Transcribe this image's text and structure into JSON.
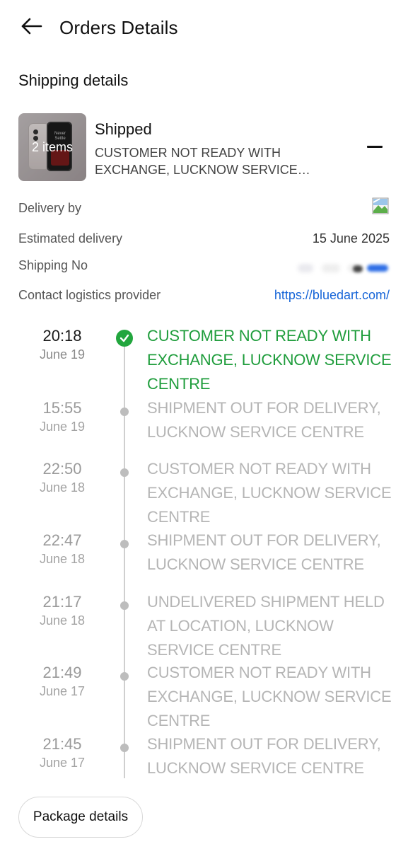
{
  "header": {
    "title": "Orders Details"
  },
  "shipping": {
    "section_title": "Shipping details",
    "thumb_count": "2 items",
    "thumb_screen_text": "Never Settle",
    "status": "Shipped",
    "description": "CUSTOMER NOT READY WITH EXCHANGE, LUCKNOW SERVICE…"
  },
  "info": {
    "delivery_label": "Delivery by",
    "estimated_label": "Estimated delivery",
    "estimated_value": "15 June 2025",
    "shipping_no_label": "Shipping No",
    "contact_label": "Contact logistics provider",
    "contact_link": "https://bluedart.com/"
  },
  "timeline": [
    {
      "time": "20:18",
      "date": "June 19",
      "text": "CUSTOMER NOT READY WITH EXCHANGE, LUCKNOW SERVICE CENTRE",
      "active": true
    },
    {
      "time": "15:55",
      "date": "June 19",
      "text": "SHIPMENT OUT FOR DELIVERY, LUCKNOW SERVICE CENTRE"
    },
    {
      "time": "22:50",
      "date": "June 18",
      "text": "CUSTOMER NOT READY WITH EXCHANGE, LUCKNOW SERVICE CENTRE"
    },
    {
      "time": "22:47",
      "date": "June 18",
      "text": "SHIPMENT OUT FOR DELIVERY, LUCKNOW SERVICE CENTRE"
    },
    {
      "time": "21:17",
      "date": "June 18",
      "text": "UNDELIVERED SHIPMENT HELD AT LOCATION, LUCKNOW SERVICE CENTRE"
    },
    {
      "time": "21:49",
      "date": "June 17",
      "text": "CUSTOMER NOT READY WITH EXCHANGE, LUCKNOW SERVICE CENTRE"
    },
    {
      "time": "21:45",
      "date": "June 17",
      "text": "SHIPMENT OUT FOR DELIVERY, LUCKNOW SERVICE CENTRE"
    }
  ],
  "footer": {
    "package_button": "Package details"
  },
  "colors": {
    "active": "#1f9d3c",
    "link": "#1665d8",
    "inactive": "#b5b5b5"
  }
}
